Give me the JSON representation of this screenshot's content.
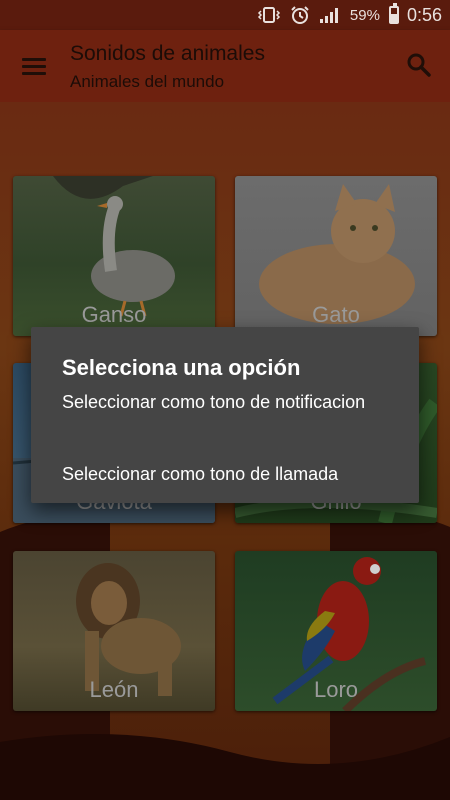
{
  "status_bar": {
    "battery_percent": "59%",
    "time": "0:56",
    "icons": [
      "vibrate-icon",
      "alarm-icon",
      "signal-icon",
      "battery-icon"
    ]
  },
  "app_bar": {
    "title": "Sonidos de animales",
    "subtitle": "Animales del mundo",
    "icons": [
      "menu-icon",
      "search-icon"
    ]
  },
  "grid": {
    "cards": [
      {
        "label": "Ganso"
      },
      {
        "label": "Gato"
      },
      {
        "label": "Gaviota"
      },
      {
        "label": "Grillo"
      },
      {
        "label": "León"
      },
      {
        "label": "Loro"
      }
    ]
  },
  "dialog": {
    "title": "Selecciona una opción",
    "options": [
      {
        "label": "Seleccionar como tono de notificacion"
      },
      {
        "label": "Seleccionar como tono de llamada"
      }
    ]
  },
  "colors": {
    "app_bar": "#6e210f",
    "status_bar": "#5a1b0d",
    "dialog_bg": "#454545"
  }
}
